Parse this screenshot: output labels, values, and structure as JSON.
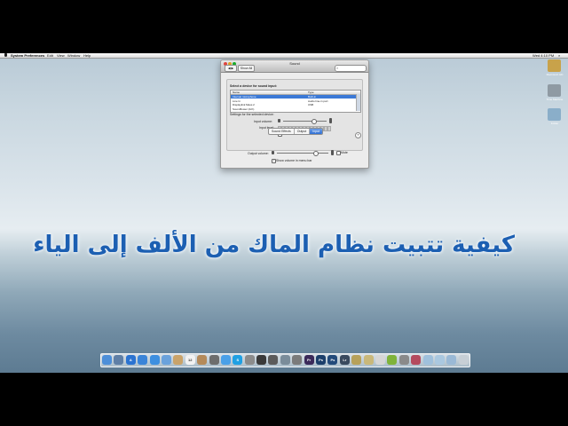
{
  "menubar": {
    "app": "System Preferences",
    "items": [
      "Edit",
      "View",
      "Window",
      "Help"
    ],
    "clock": "Wed 4:10 PM"
  },
  "desktop": {
    "icons": [
      {
        "label": "Macintosh HD",
        "icon": "hard-drive-icon",
        "color": "#c8a24a"
      },
      {
        "label": "Time Machine",
        "icon": "time-machine-icon",
        "color": "#8f9aa3"
      },
      {
        "label": "Folder",
        "icon": "folder-icon",
        "color": "#8aaec9"
      }
    ]
  },
  "window": {
    "title": "Sound",
    "show_all": "Show All",
    "tabs": [
      "Sound Effects",
      "Output",
      "Input"
    ],
    "selected_tab": 2,
    "section_title": "Select a device for sound input:",
    "table": {
      "headers": [
        "Name",
        "Type"
      ],
      "rows": [
        {
          "name": "Internal microphone",
          "type": "Built-in",
          "selected": true
        },
        {
          "name": "Line In",
          "type": "Audio line-in port",
          "selected": false
        },
        {
          "name": "Displaylink Mass 2",
          "type": "USB",
          "selected": false
        },
        {
          "name": "Soundflower (2ch)",
          "type": "",
          "selected": false
        }
      ]
    },
    "settings_label": "Settings for the selected device:",
    "input_volume_label": "Input volume:",
    "input_volume": 0.7,
    "input_level_label": "Input level:",
    "input_level_segments": 15,
    "noise_reduction_label": "Use ambient noise reduction",
    "noise_reduction_checked": true,
    "help": "?",
    "output_volume_label": "Output volume:",
    "output_volume": 0.75,
    "mute_label": "Mute",
    "show_volume_label": "Show volume in menu bar",
    "show_volume_checked": true
  },
  "headline": "كيفية تتبيت نظام الماك من الألف  إلى الياء",
  "dock": [
    {
      "icon": "finder-icon",
      "color": "#4d8fd9",
      "glyph": ""
    },
    {
      "icon": "mission-control-icon",
      "color": "#5f7fa6",
      "glyph": ""
    },
    {
      "icon": "app-store-icon",
      "color": "#2b73d1",
      "glyph": "A"
    },
    {
      "icon": "mail-icon",
      "color": "#3a84d8",
      "glyph": ""
    },
    {
      "icon": "safari-icon",
      "color": "#3d8fe0",
      "glyph": ""
    },
    {
      "icon": "ichat-icon",
      "color": "#6aa2dc",
      "glyph": ""
    },
    {
      "icon": "preview-icon",
      "color": "#c9a36a",
      "glyph": ""
    },
    {
      "icon": "calendar-icon",
      "color": "#f2f2f2",
      "glyph": "12"
    },
    {
      "icon": "address-book-icon",
      "color": "#b48a5a",
      "glyph": ""
    },
    {
      "icon": "photo-booth-icon",
      "color": "#6d6d6d",
      "glyph": ""
    },
    {
      "icon": "itunes-icon",
      "color": "#4aa0e8",
      "glyph": ""
    },
    {
      "icon": "skype-icon",
      "color": "#1fa0e3",
      "glyph": "S"
    },
    {
      "icon": "system-preferences-icon",
      "color": "#8c8c8c",
      "glyph": ""
    },
    {
      "icon": "quicktime-icon",
      "color": "#3a3a3a",
      "glyph": ""
    },
    {
      "icon": "dvd-player-icon",
      "color": "#5b5b5b",
      "glyph": ""
    },
    {
      "icon": "app-icon",
      "color": "#7a8c9a",
      "glyph": ""
    },
    {
      "icon": "camera-icon",
      "color": "#7b7b7b",
      "glyph": ""
    },
    {
      "icon": "premiere-pro-icon",
      "color": "#3b2a5a",
      "glyph": "Pr"
    },
    {
      "icon": "photoshop-icon",
      "color": "#1c3f6b",
      "glyph": "Ps"
    },
    {
      "icon": "photoshop-alt-icon",
      "color": "#234a7a",
      "glyph": "Ps"
    },
    {
      "icon": "lightroom-icon",
      "color": "#3a4a5e",
      "glyph": "Lr"
    },
    {
      "icon": "tools-icon",
      "color": "#b7a15a",
      "glyph": ""
    },
    {
      "icon": "app-icon-2",
      "color": "#c9b87a",
      "glyph": ""
    },
    {
      "icon": "app-icon-3",
      "color": "#d6d6d6",
      "glyph": ""
    },
    {
      "icon": "android-icon",
      "color": "#7fb33a",
      "glyph": ""
    },
    {
      "icon": "app-icon-4",
      "color": "#8a8a8a",
      "glyph": ""
    },
    {
      "icon": "app-icon-5",
      "color": "#b44a5e",
      "glyph": ""
    },
    {
      "icon": "folder-icon",
      "color": "#9fc0dc",
      "glyph": ""
    },
    {
      "icon": "folder-icon-2",
      "color": "#aac8e0",
      "glyph": ""
    },
    {
      "icon": "folder-icon-3",
      "color": "#9ab9d6",
      "glyph": ""
    },
    {
      "icon": "trash-icon",
      "color": "#c7cfd6",
      "glyph": ""
    }
  ]
}
